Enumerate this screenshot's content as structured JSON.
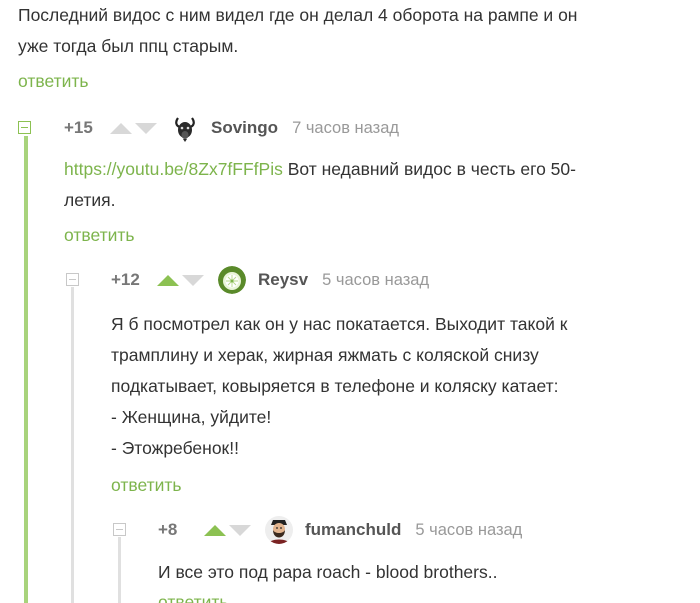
{
  "parent_comment": {
    "lines": [
      "Последний видос с ним видел где он делал 4 оборота на рампе и он",
      "уже тогда был ппц старым."
    ],
    "reply_label": "ответить"
  },
  "comments": [
    {
      "rating": "+15",
      "upvoted": false,
      "username": "Sovingo",
      "time": "7 часов назад",
      "avatar_icon": "goat-avatar-icon",
      "link": "https://youtu.be/8Zx7fFFfPis",
      "line1_rest": " Вот недавний видос в честь его 50-",
      "line2": "летия.",
      "reply_label": "ответить"
    },
    {
      "rating": "+12",
      "upvoted": true,
      "username": "Reysv",
      "time": "5 часов назад",
      "avatar_icon": "apple-avatar-icon",
      "lines": [
        "Я  б посмотрел как он у нас покатается. Выходит такой к",
        "трамплину и херак, жирная яжмать с коляской снизу",
        "подкатывает, ковыряется в телефоне и коляску катает:",
        "- Женщина, уйдите!",
        "- Этожребенок!!"
      ],
      "reply_label": "ответить"
    },
    {
      "rating": "+8",
      "upvoted": true,
      "username": "fumanchuld",
      "time": "5 часов назад",
      "avatar_icon": "bearded-man-avatar-icon",
      "lines": [
        "И все это под papa roach - blood brothers.."
      ],
      "reply_label": "ответить"
    }
  ],
  "colors": {
    "accent_green": "#7db44c",
    "branch_green": "#a8d37c",
    "text": "#333333",
    "muted": "#999999"
  }
}
